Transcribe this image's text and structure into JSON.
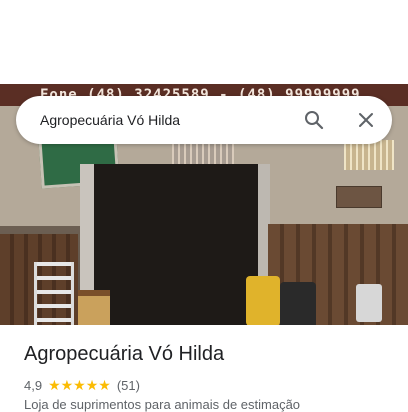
{
  "photo": {
    "sign_text": "Fone (48) 32425589 - (48) 99999999"
  },
  "search": {
    "query": "Agropecuária Vó Hilda",
    "search_icon": "search-icon",
    "close_icon": "close-icon"
  },
  "place": {
    "title": "Agropecuária Vó Hilda",
    "rating": "4,9",
    "stars": "★★★★★",
    "review_count": "(51)",
    "category": "Loja de suprimentos para animais de estimação"
  },
  "colors": {
    "star": "#fbbc04",
    "title_text": "#202124",
    "secondary_text": "#5f6368"
  }
}
